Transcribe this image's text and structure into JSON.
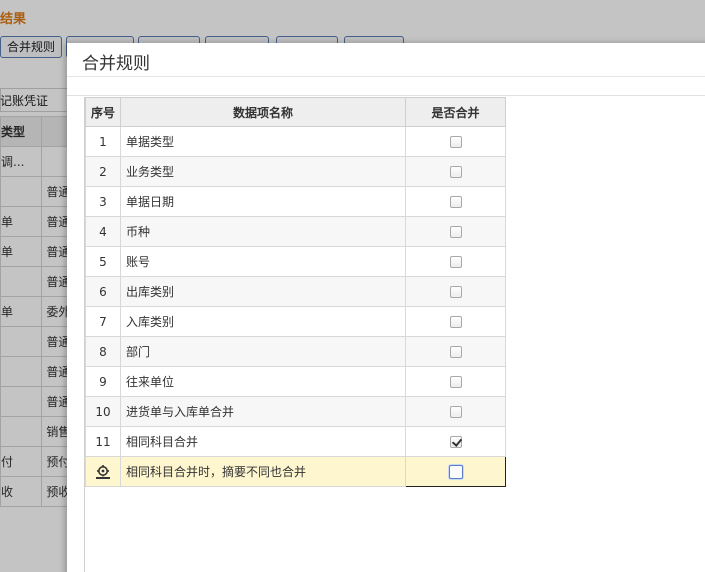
{
  "background": {
    "title": "结果",
    "toolbar_first_button": "合并规则",
    "filter_label": "记账凭证",
    "table_header": [
      "类型",
      ""
    ],
    "rows": [
      [
        "调...",
        ""
      ],
      [
        "",
        "普通"
      ],
      [
        "单",
        "普通"
      ],
      [
        "单",
        "普通"
      ],
      [
        "",
        "普通"
      ],
      [
        "单",
        "委外"
      ],
      [
        "",
        "普通"
      ],
      [
        "",
        "普通"
      ],
      [
        "",
        "普通"
      ],
      [
        "",
        "销售"
      ],
      [
        "付",
        "预付"
      ],
      [
        "收",
        "预收"
      ]
    ]
  },
  "dialog": {
    "title": "合并规则",
    "columns": {
      "seq": "序号",
      "name": "数据项名称",
      "merge": "是否合并"
    },
    "rows": [
      {
        "seq": "1",
        "name": "单据类型",
        "merge": false
      },
      {
        "seq": "2",
        "name": "业务类型",
        "merge": false
      },
      {
        "seq": "3",
        "name": "单据日期",
        "merge": false
      },
      {
        "seq": "4",
        "name": "币种",
        "merge": false
      },
      {
        "seq": "5",
        "name": "账号",
        "merge": false
      },
      {
        "seq": "6",
        "name": "出库类别",
        "merge": false
      },
      {
        "seq": "7",
        "name": "入库类别",
        "merge": false
      },
      {
        "seq": "8",
        "name": "部门",
        "merge": false
      },
      {
        "seq": "9",
        "name": "往来单位",
        "merge": false
      },
      {
        "seq": "10",
        "name": "进货单与入库单合并",
        "merge": false
      },
      {
        "seq": "11",
        "name": "相同科目合并",
        "merge": true
      }
    ],
    "active_row": {
      "icon": "row-edit-icon",
      "name": "相同科目合并时，摘要不同也合并",
      "merge": false
    }
  },
  "colors": {
    "accent_title": "#e07b15",
    "active_row_bg": "#fdf6cf",
    "button_border": "#5a7fb5"
  }
}
